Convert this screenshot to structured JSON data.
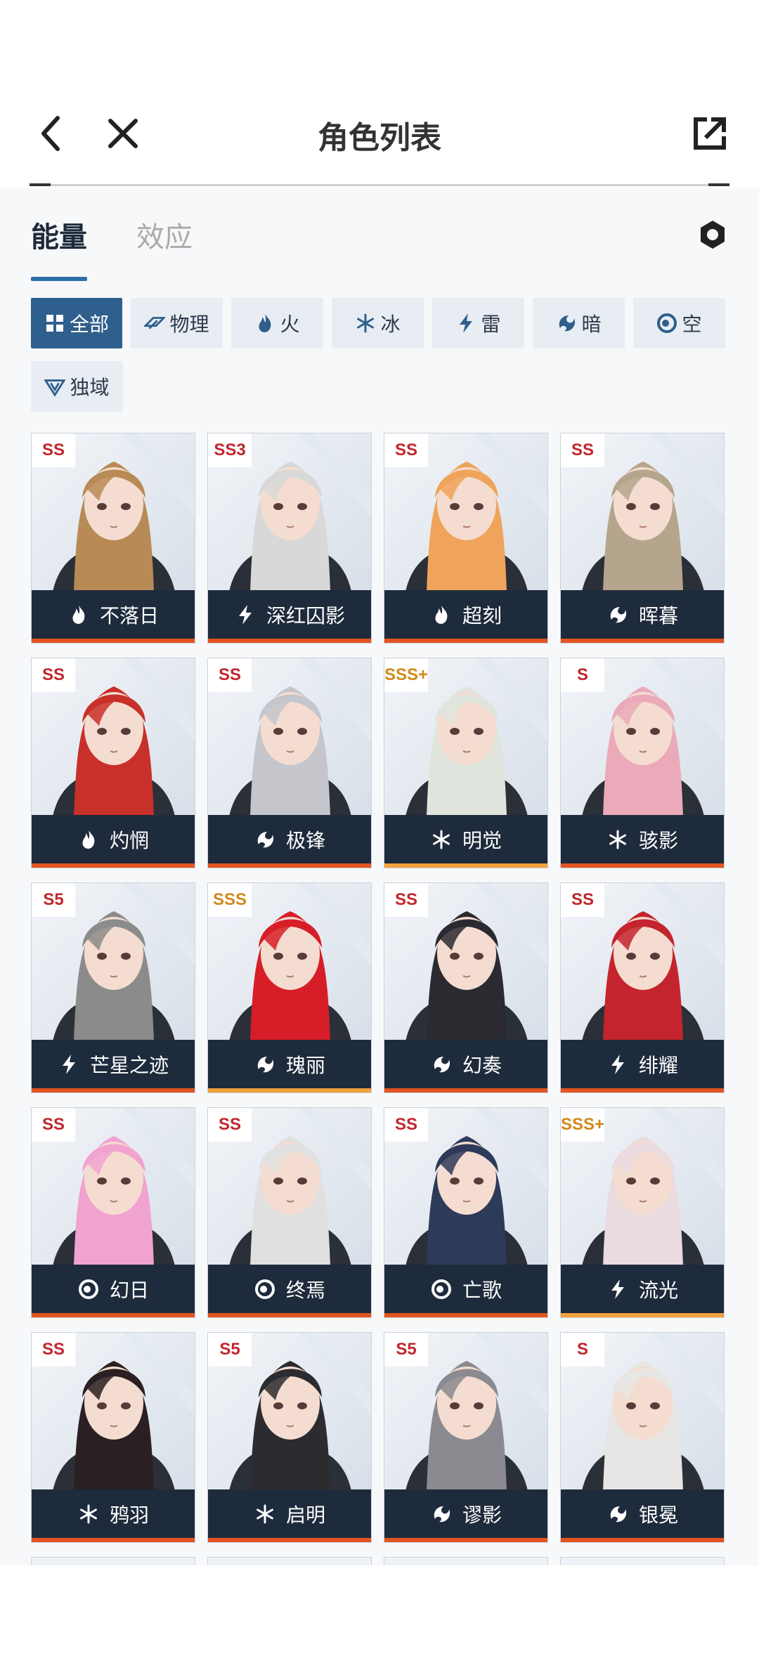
{
  "header": {
    "title": "角色列表"
  },
  "tabs": [
    {
      "label": "能量",
      "active": true
    },
    {
      "label": "效应",
      "active": false
    }
  ],
  "filters": [
    {
      "label": "全部",
      "icon": "grid-icon",
      "active": true
    },
    {
      "label": "物理",
      "icon": "physical-icon",
      "active": false
    },
    {
      "label": "火",
      "icon": "fire-icon",
      "active": false
    },
    {
      "label": "冰",
      "icon": "ice-icon",
      "active": false
    },
    {
      "label": "雷",
      "icon": "thunder-icon",
      "active": false
    },
    {
      "label": "暗",
      "icon": "dark-icon",
      "active": false
    },
    {
      "label": "空",
      "icon": "void-icon",
      "active": false
    },
    {
      "label": "独域",
      "icon": "domain-icon",
      "active": false
    }
  ],
  "characters": [
    {
      "name": "不落日",
      "rank": "SS",
      "element": "fire-icon",
      "hair": "#b88a55"
    },
    {
      "name": "深红囚影",
      "rank": "SS3",
      "element": "thunder-icon",
      "hair": "#d8d8d8"
    },
    {
      "name": "超刻",
      "rank": "SS",
      "element": "fire-icon",
      "hair": "#f0a35a"
    },
    {
      "name": "晖暮",
      "rank": "SS",
      "element": "dark-icon",
      "hair": "#b5a58c"
    },
    {
      "name": "灼惘",
      "rank": "SS",
      "element": "fire-icon",
      "hair": "#c8302a"
    },
    {
      "name": "极锋",
      "rank": "SS",
      "element": "dark-icon",
      "hair": "#c4c6cc"
    },
    {
      "name": "明觉",
      "rank": "SSS+",
      "element": "ice-icon",
      "hair": "#dfe5dc",
      "gold": true
    },
    {
      "name": "骇影",
      "rank": "S",
      "element": "ice-icon",
      "hair": "#eaaab9"
    },
    {
      "name": "芒星之迹",
      "rank": "S5",
      "element": "thunder-icon",
      "hair": "#8b8b8b"
    },
    {
      "name": "瑰丽",
      "rank": "SSS",
      "element": "dark-icon",
      "hair": "#d71e28",
      "gold": true
    },
    {
      "name": "幻奏",
      "rank": "SS",
      "element": "dark-icon",
      "hair": "#2a2a30"
    },
    {
      "name": "绯耀",
      "rank": "SS",
      "element": "thunder-icon",
      "hair": "#c4242d"
    },
    {
      "name": "幻日",
      "rank": "SS",
      "element": "void-icon",
      "hair": "#f1a3cf"
    },
    {
      "name": "终焉",
      "rank": "SS",
      "element": "void-icon",
      "hair": "#e0e0e0"
    },
    {
      "name": "亡歌",
      "rank": "SS",
      "element": "void-icon",
      "hair": "#2e3a5a"
    },
    {
      "name": "流光",
      "rank": "SSS+",
      "element": "thunder-icon",
      "hair": "#eadbe0",
      "gold": true
    },
    {
      "name": "鸦羽",
      "rank": "SS",
      "element": "ice-icon",
      "hair": "#2a1f22"
    },
    {
      "name": "启明",
      "rank": "S5",
      "element": "ice-icon",
      "hair": "#2c2c30"
    },
    {
      "name": "谬影",
      "rank": "S5",
      "element": "dark-icon",
      "hair": "#8a8a90"
    },
    {
      "name": "银冕",
      "rank": "S",
      "element": "dark-icon",
      "hair": "#e8e6e4"
    }
  ]
}
